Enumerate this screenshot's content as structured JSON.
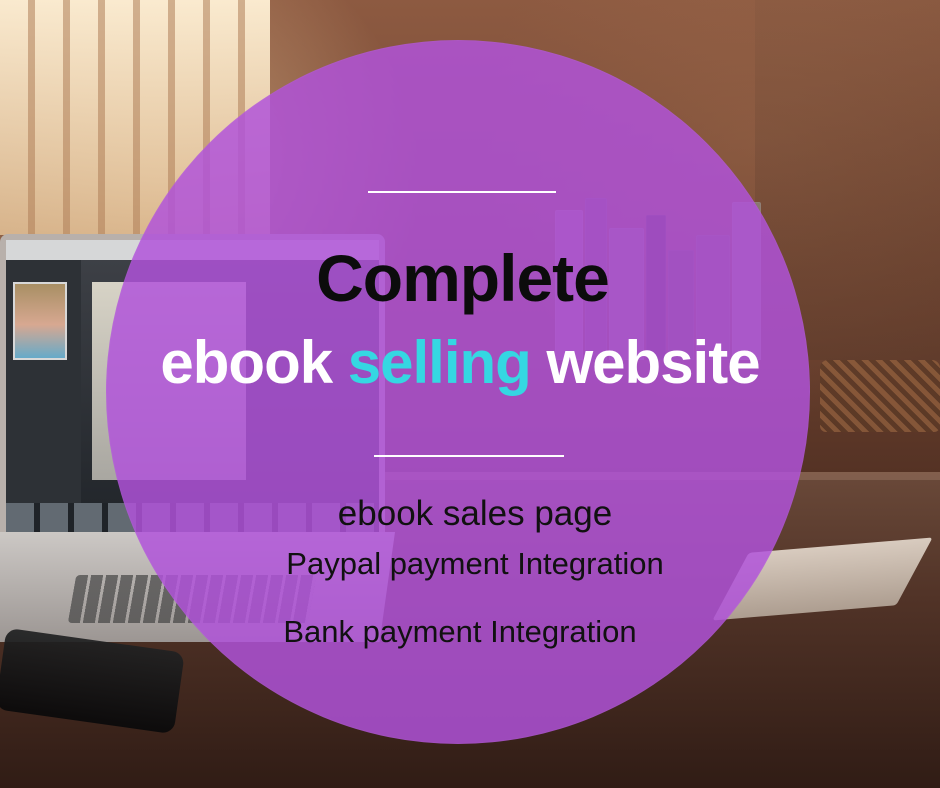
{
  "content": {
    "headline_top": "Complete",
    "headline_bottom": {
      "part1": "ebook ",
      "accent": "selling",
      "part3": " website"
    },
    "features": [
      "ebook sales page",
      "Paypal payment Integration",
      "Bank payment Integration"
    ]
  },
  "colors": {
    "overlay_purple": "#B052DA",
    "accent_cyan": "#35D7E2",
    "headline_black": "#0C0C0C",
    "headline_white": "#FFFFFF",
    "divider_white": "#FFFFFF"
  },
  "icons": [
    "divider-line-top",
    "divider-line-middle"
  ]
}
